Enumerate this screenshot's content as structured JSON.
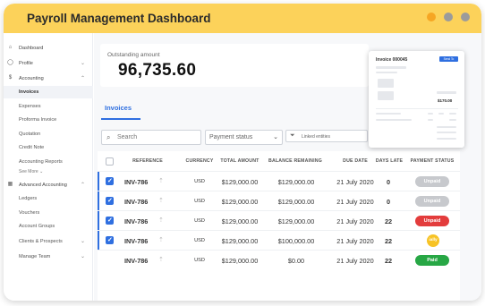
{
  "window": {
    "title": "Payroll Management Dashboard"
  },
  "sidebar": {
    "items": [
      {
        "label": "Dashboard",
        "icon": "home-icon"
      },
      {
        "label": "Profile",
        "icon": "user-icon"
      },
      {
        "label": "Accounting",
        "icon": "dollar-icon"
      },
      {
        "label": "Invoices"
      },
      {
        "label": "Expenses"
      },
      {
        "label": "Proforma Invoice"
      },
      {
        "label": "Quotation"
      },
      {
        "label": "Credit Note"
      },
      {
        "label": "Accounting Reports"
      },
      {
        "label": "Advanced Accounting",
        "icon": "calculator-icon"
      },
      {
        "label": "Ledgers"
      },
      {
        "label": "Vouchers"
      },
      {
        "label": "Account Groups"
      },
      {
        "label": "Clients & Prospects"
      },
      {
        "label": "Manage Team"
      }
    ],
    "see_more": "See More"
  },
  "summary": {
    "label": "Outstanding amount",
    "value": "96,735.60"
  },
  "tabs": [
    {
      "label": "Invoices"
    }
  ],
  "filters": {
    "search_placeholder": "Search",
    "status_placeholder": "Payment status",
    "linked_placeholder": "Linked entities"
  },
  "table": {
    "headers": [
      "REFERENCE",
      "CURRENCY",
      "TOTAL AMOUNT",
      "BALANCE REMAINING",
      "DUE DATE",
      "DAYS LATE",
      "PAYMENT STATUS"
    ],
    "rows": [
      {
        "ref": "INV-786",
        "currency": "USD",
        "total": "$129,000.00",
        "balance": "$129,000.00",
        "due": "21 July 2020",
        "late": "0",
        "status": "Unpaid",
        "checked": true
      },
      {
        "ref": "INV-786",
        "currency": "USD",
        "total": "$129,000.00",
        "balance": "$129,000.00",
        "due": "21 July 2020",
        "late": "0",
        "status": "Unpaid",
        "checked": true
      },
      {
        "ref": "INV-786",
        "currency": "USD",
        "total": "$129,000.00",
        "balance": "$129,000.00",
        "due": "21 July 2020",
        "late": "22",
        "status": "Unpaid",
        "checked": true
      },
      {
        "ref": "INV-786",
        "currency": "USD",
        "total": "$129,000.00",
        "balance": "$100,000.00",
        "due": "21 July 2020",
        "late": "22",
        "status": "ially",
        "checked": true
      },
      {
        "ref": "INV-786",
        "currency": "USD",
        "total": "$129,000.00",
        "balance": "$0.00",
        "due": "21 July 2020",
        "late": "22",
        "status": "Paid",
        "checked": false
      }
    ]
  },
  "preview": {
    "title": "Invoice 000045",
    "button": "Send To",
    "total": "$170.00"
  },
  "colors": {
    "titlebar": "#fcd25a",
    "accent": "#2f6fe0",
    "unpaid_red": "#e33c3c",
    "paid_green": "#27a745",
    "partial_yellow": "#f7c325"
  }
}
